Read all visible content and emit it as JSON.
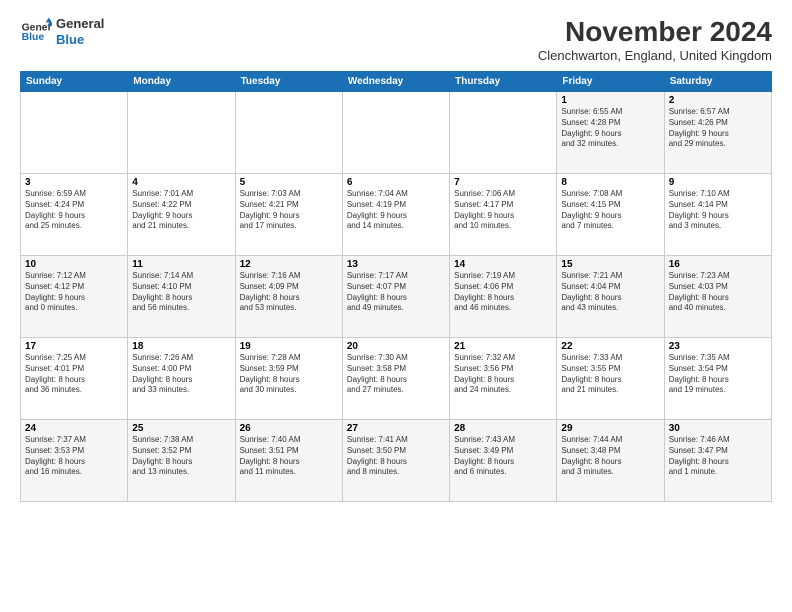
{
  "logo": {
    "line1": "General",
    "line2": "Blue"
  },
  "title": "November 2024",
  "location": "Clenchwarton, England, United Kingdom",
  "days_of_week": [
    "Sunday",
    "Monday",
    "Tuesday",
    "Wednesday",
    "Thursday",
    "Friday",
    "Saturday"
  ],
  "weeks": [
    [
      {
        "day": "",
        "info": ""
      },
      {
        "day": "",
        "info": ""
      },
      {
        "day": "",
        "info": ""
      },
      {
        "day": "",
        "info": ""
      },
      {
        "day": "",
        "info": ""
      },
      {
        "day": "1",
        "info": "Sunrise: 6:55 AM\nSunset: 4:28 PM\nDaylight: 9 hours\nand 32 minutes."
      },
      {
        "day": "2",
        "info": "Sunrise: 6:57 AM\nSunset: 4:26 PM\nDaylight: 9 hours\nand 29 minutes."
      }
    ],
    [
      {
        "day": "3",
        "info": "Sunrise: 6:59 AM\nSunset: 4:24 PM\nDaylight: 9 hours\nand 25 minutes."
      },
      {
        "day": "4",
        "info": "Sunrise: 7:01 AM\nSunset: 4:22 PM\nDaylight: 9 hours\nand 21 minutes."
      },
      {
        "day": "5",
        "info": "Sunrise: 7:03 AM\nSunset: 4:21 PM\nDaylight: 9 hours\nand 17 minutes."
      },
      {
        "day": "6",
        "info": "Sunrise: 7:04 AM\nSunset: 4:19 PM\nDaylight: 9 hours\nand 14 minutes."
      },
      {
        "day": "7",
        "info": "Sunrise: 7:06 AM\nSunset: 4:17 PM\nDaylight: 9 hours\nand 10 minutes."
      },
      {
        "day": "8",
        "info": "Sunrise: 7:08 AM\nSunset: 4:15 PM\nDaylight: 9 hours\nand 7 minutes."
      },
      {
        "day": "9",
        "info": "Sunrise: 7:10 AM\nSunset: 4:14 PM\nDaylight: 9 hours\nand 3 minutes."
      }
    ],
    [
      {
        "day": "10",
        "info": "Sunrise: 7:12 AM\nSunset: 4:12 PM\nDaylight: 9 hours\nand 0 minutes."
      },
      {
        "day": "11",
        "info": "Sunrise: 7:14 AM\nSunset: 4:10 PM\nDaylight: 8 hours\nand 56 minutes."
      },
      {
        "day": "12",
        "info": "Sunrise: 7:16 AM\nSunset: 4:09 PM\nDaylight: 8 hours\nand 53 minutes."
      },
      {
        "day": "13",
        "info": "Sunrise: 7:17 AM\nSunset: 4:07 PM\nDaylight: 8 hours\nand 49 minutes."
      },
      {
        "day": "14",
        "info": "Sunrise: 7:19 AM\nSunset: 4:06 PM\nDaylight: 8 hours\nand 46 minutes."
      },
      {
        "day": "15",
        "info": "Sunrise: 7:21 AM\nSunset: 4:04 PM\nDaylight: 8 hours\nand 43 minutes."
      },
      {
        "day": "16",
        "info": "Sunrise: 7:23 AM\nSunset: 4:03 PM\nDaylight: 8 hours\nand 40 minutes."
      }
    ],
    [
      {
        "day": "17",
        "info": "Sunrise: 7:25 AM\nSunset: 4:01 PM\nDaylight: 8 hours\nand 36 minutes."
      },
      {
        "day": "18",
        "info": "Sunrise: 7:26 AM\nSunset: 4:00 PM\nDaylight: 8 hours\nand 33 minutes."
      },
      {
        "day": "19",
        "info": "Sunrise: 7:28 AM\nSunset: 3:59 PM\nDaylight: 8 hours\nand 30 minutes."
      },
      {
        "day": "20",
        "info": "Sunrise: 7:30 AM\nSunset: 3:58 PM\nDaylight: 8 hours\nand 27 minutes."
      },
      {
        "day": "21",
        "info": "Sunrise: 7:32 AM\nSunset: 3:56 PM\nDaylight: 8 hours\nand 24 minutes."
      },
      {
        "day": "22",
        "info": "Sunrise: 7:33 AM\nSunset: 3:55 PM\nDaylight: 8 hours\nand 21 minutes."
      },
      {
        "day": "23",
        "info": "Sunrise: 7:35 AM\nSunset: 3:54 PM\nDaylight: 8 hours\nand 19 minutes."
      }
    ],
    [
      {
        "day": "24",
        "info": "Sunrise: 7:37 AM\nSunset: 3:53 PM\nDaylight: 8 hours\nand 16 minutes."
      },
      {
        "day": "25",
        "info": "Sunrise: 7:38 AM\nSunset: 3:52 PM\nDaylight: 8 hours\nand 13 minutes."
      },
      {
        "day": "26",
        "info": "Sunrise: 7:40 AM\nSunset: 3:51 PM\nDaylight: 8 hours\nand 11 minutes."
      },
      {
        "day": "27",
        "info": "Sunrise: 7:41 AM\nSunset: 3:50 PM\nDaylight: 8 hours\nand 8 minutes."
      },
      {
        "day": "28",
        "info": "Sunrise: 7:43 AM\nSunset: 3:49 PM\nDaylight: 8 hours\nand 6 minutes."
      },
      {
        "day": "29",
        "info": "Sunrise: 7:44 AM\nSunset: 3:48 PM\nDaylight: 8 hours\nand 3 minutes."
      },
      {
        "day": "30",
        "info": "Sunrise: 7:46 AM\nSunset: 3:47 PM\nDaylight: 8 hours\nand 1 minute."
      }
    ]
  ]
}
